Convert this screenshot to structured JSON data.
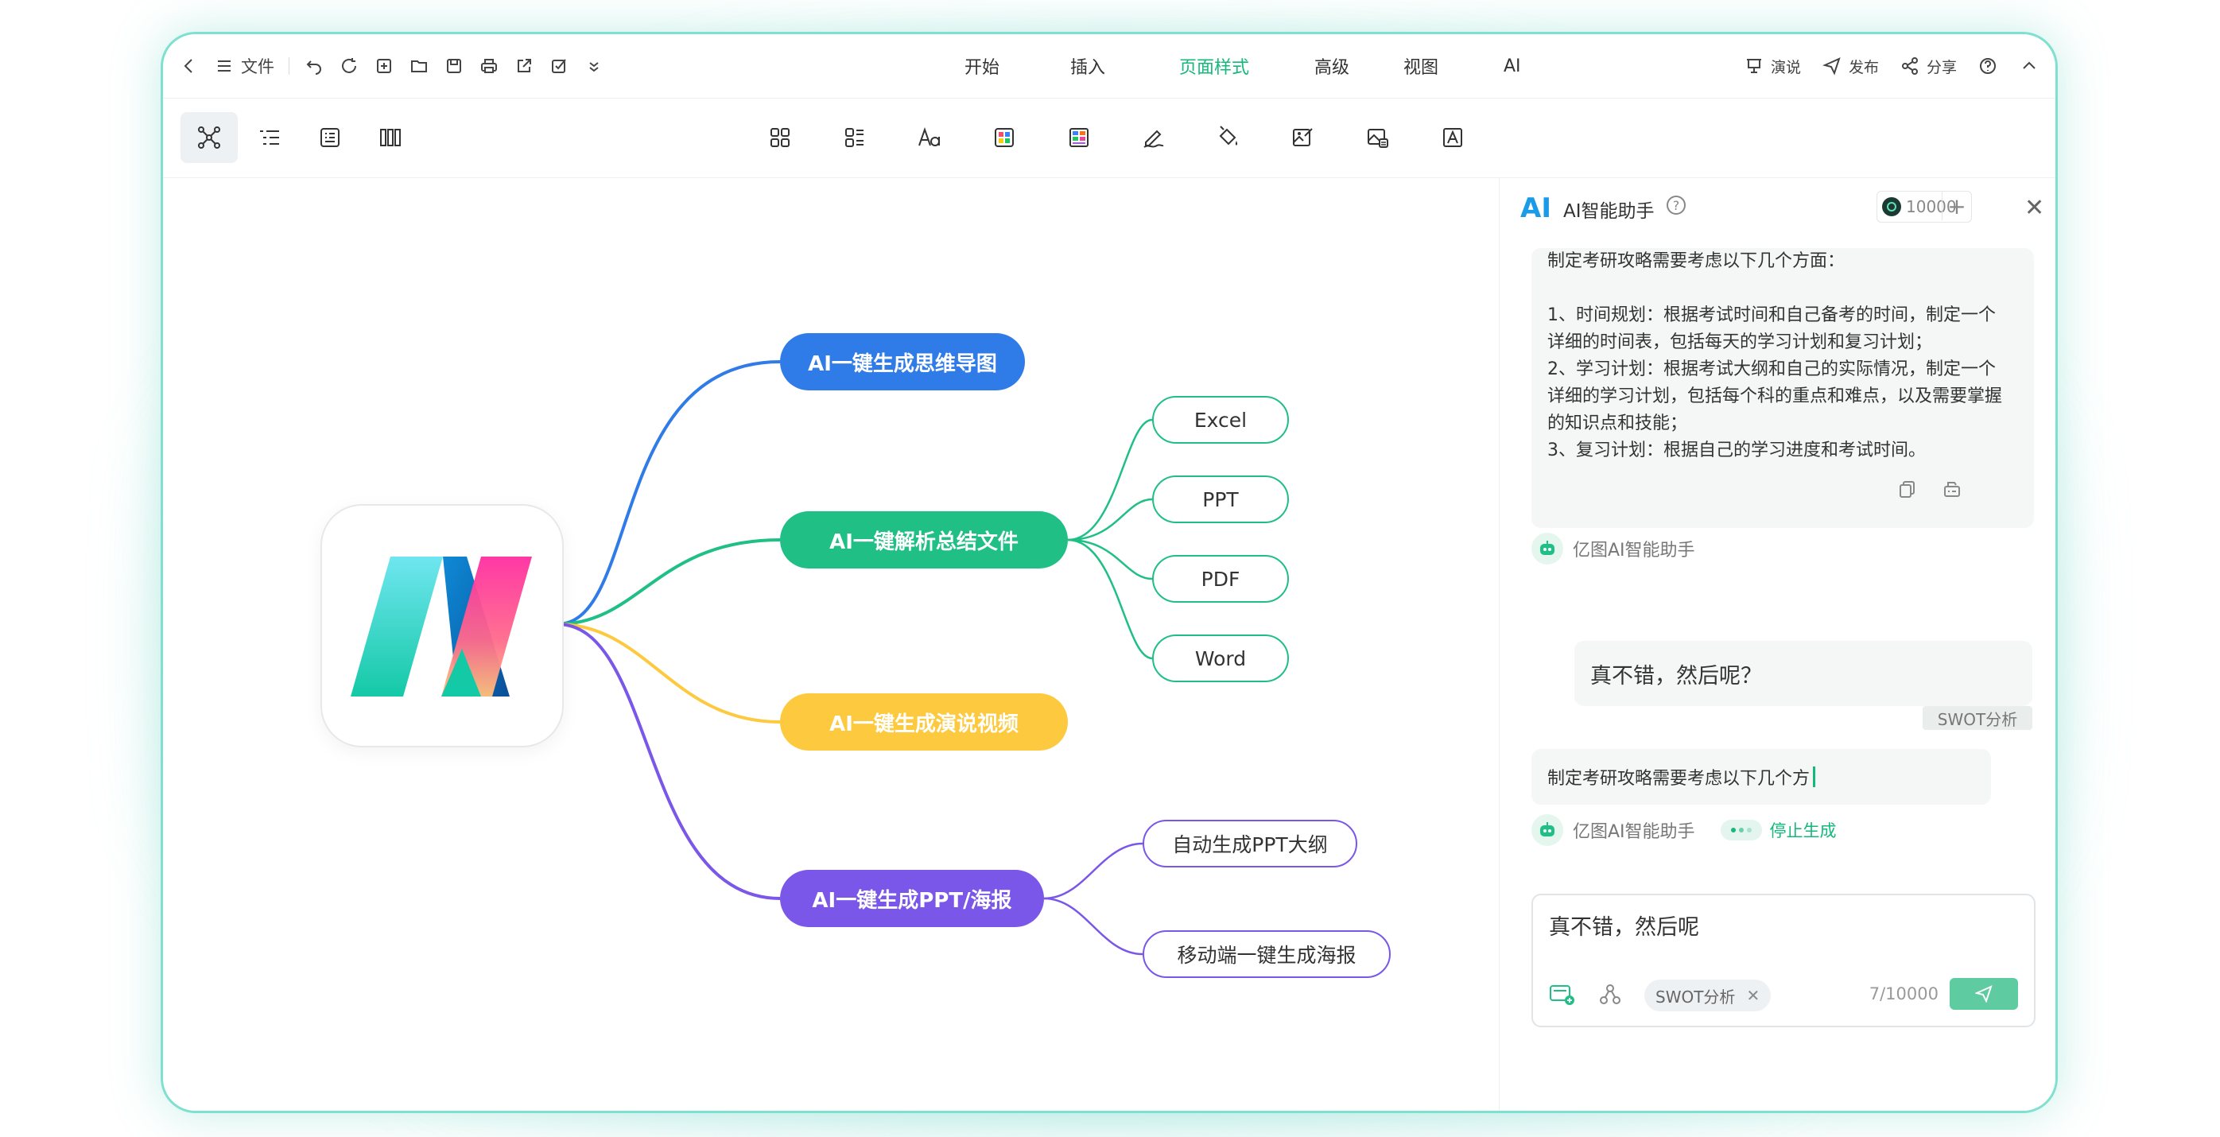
{
  "titlebar": {
    "file_label": "文件",
    "tabs": [
      {
        "label": "开始",
        "active": false
      },
      {
        "label": "插入",
        "active": false
      },
      {
        "label": "页面样式",
        "active": true
      },
      {
        "label": "高级",
        "active": false
      },
      {
        "label": "视图",
        "active": false
      },
      {
        "label": "AI",
        "active": false
      }
    ],
    "present_label": "演说",
    "publish_label": "发布",
    "share_label": "分享"
  },
  "mindmap": {
    "branches": [
      {
        "label": "AI一键生成思维导图",
        "color": "#2f7be8"
      },
      {
        "label": "AI一键解析总结文件",
        "color": "#1fbf86"
      },
      {
        "label": "AI一键生成演说视频",
        "color": "#fdc93f"
      },
      {
        "label": "AI一键生成PPT/海报",
        "color": "#7a57e8"
      }
    ],
    "file_types": [
      "Excel",
      "PPT",
      "PDF",
      "Word"
    ],
    "ppt_children": [
      "自动生成PPT大纲",
      "移动端一键生成海报"
    ]
  },
  "assistant": {
    "logo_text": "AI",
    "title": "AI智能助手",
    "credits": "10000",
    "answer_lines": [
      "制定考研攻略需要考虑以下几个方面：",
      "",
      "1、时间规划：根据考试时间和自己备考的时间，制定一个",
      "详细的时间表，包括每天的学习计划和复习计划；",
      "2、学习计划：根据考试大纲和自己的实际情况，制定一个",
      "详细的学习计划，包括每个科的重点和难点，以及需要掌握",
      "的知识点和技能；",
      "3、复习计划：根据自己的学习进度和考试时间。"
    ],
    "bot_name": "亿图AI智能助手",
    "user_message": "真不错，然后呢？",
    "user_tag": "SWOT分析",
    "streaming_text": "制定考研攻略需要考虑以下几个方",
    "stop_label": "停止生成",
    "input_value": "真不错，然后呢",
    "chip_label": "SWOT分析",
    "counter": "7/10000"
  }
}
